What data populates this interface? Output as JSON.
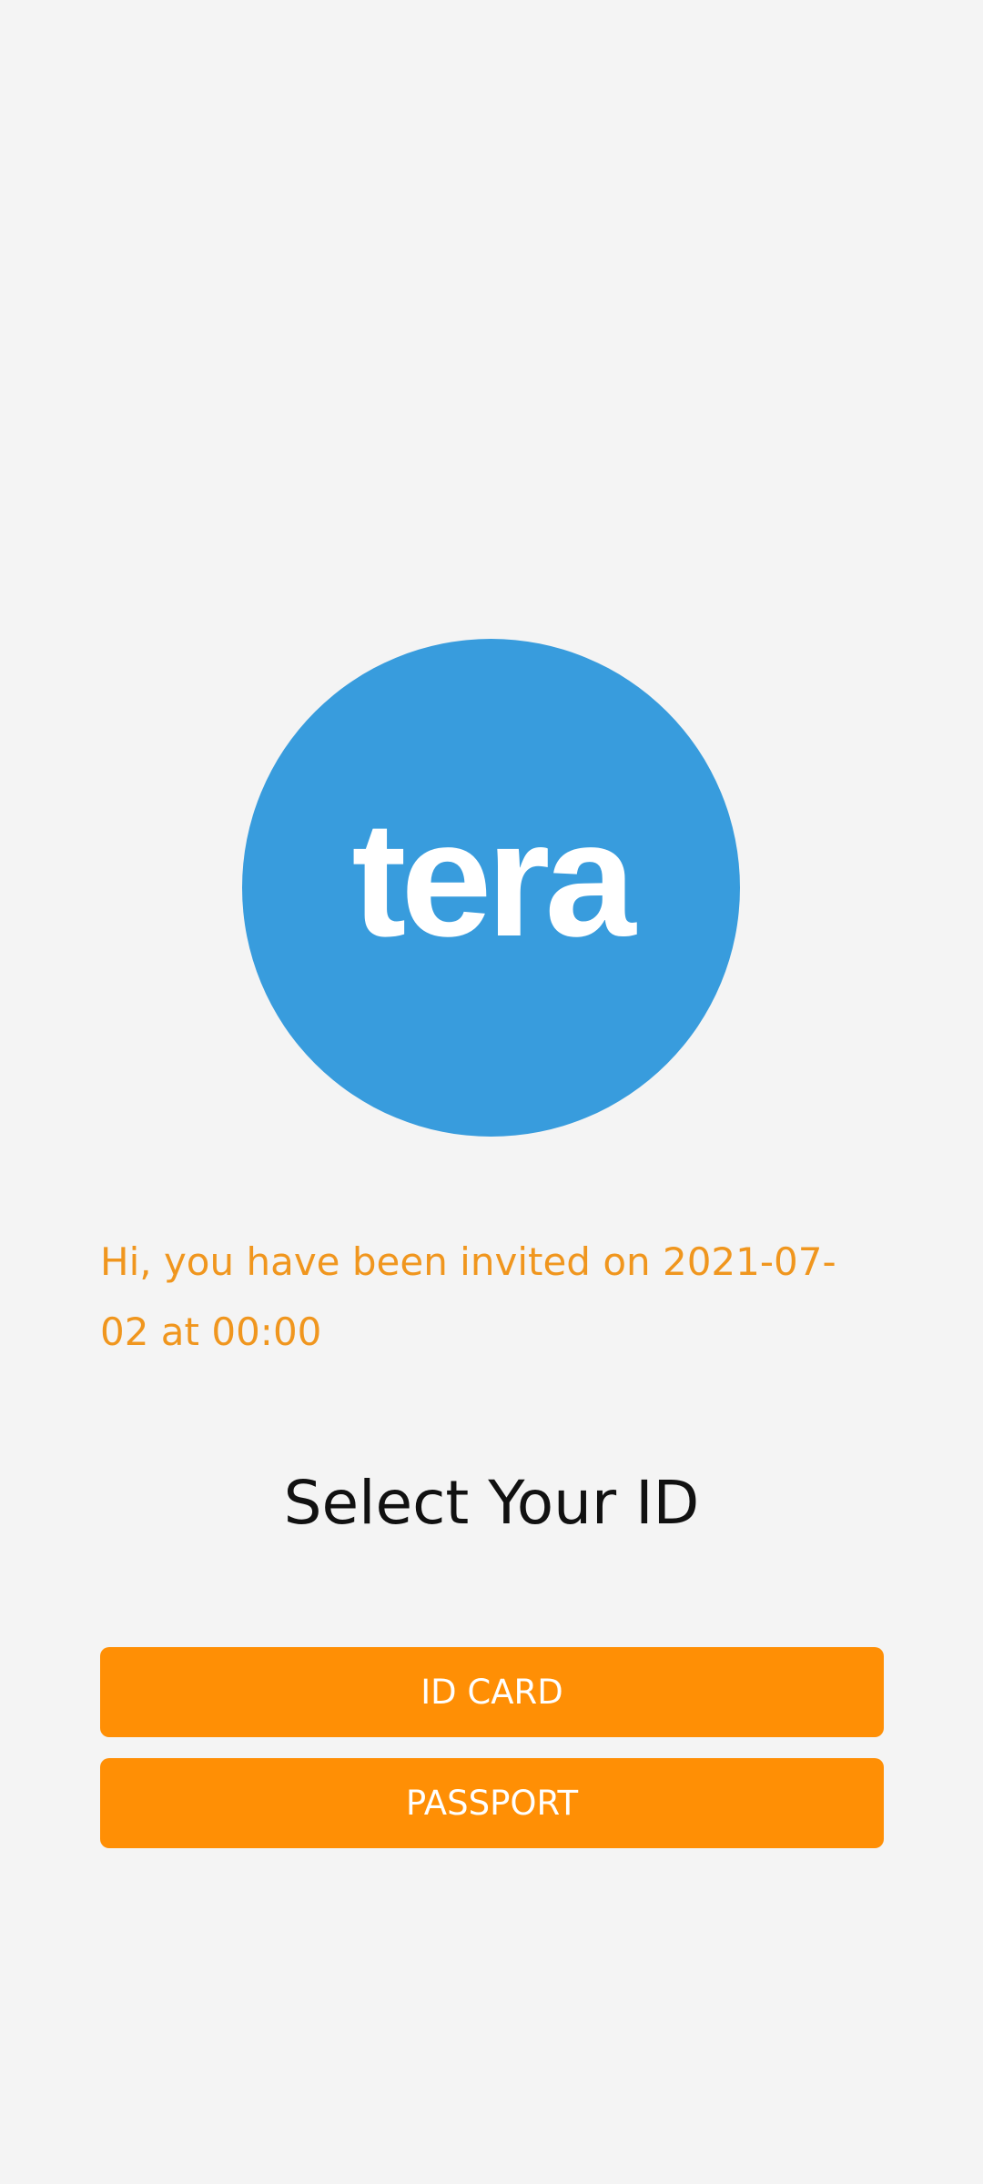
{
  "logo": {
    "text": "tera",
    "color": "#389cdd"
  },
  "invite": {
    "message": "Hi, you have been invited on 2021-07-02 at 00:00",
    "color": "#f0961e"
  },
  "select_id": {
    "title": "Select Your ID"
  },
  "buttons": {
    "id_card_label": "ID CARD",
    "passport_label": "PASSPORT",
    "color": "#ff8f05"
  }
}
